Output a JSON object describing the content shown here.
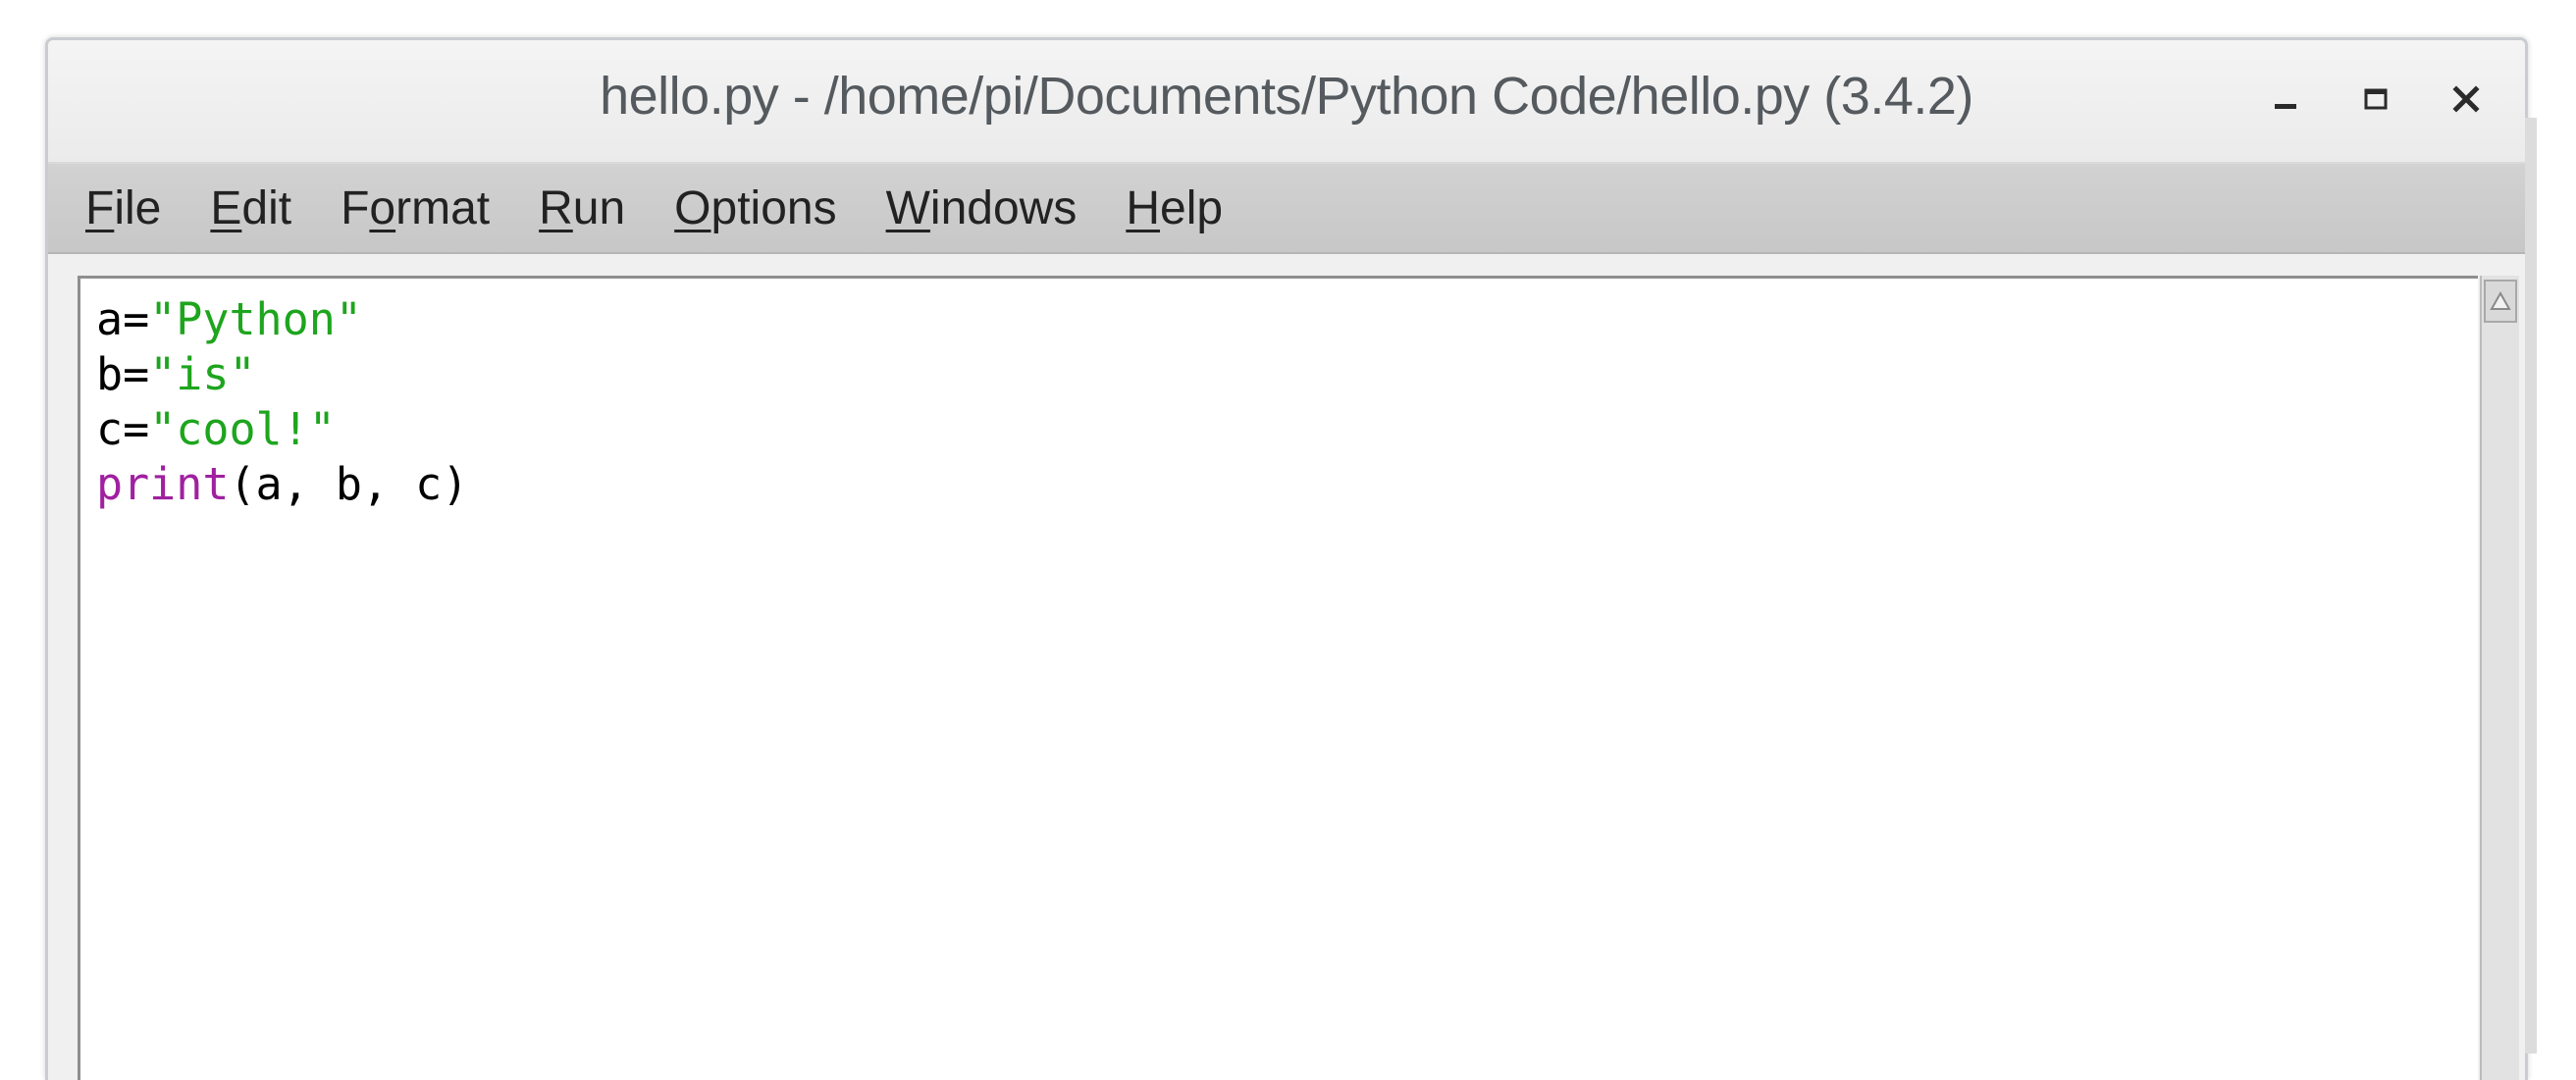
{
  "window": {
    "title": "hello.py - /home/pi/Documents/Python Code/hello.py (3.4.2)",
    "controls": {
      "minimize_icon": "minimize-icon",
      "maximize_icon": "maximize-icon",
      "close_icon": "close-icon"
    }
  },
  "menubar": {
    "items": [
      {
        "first": "F",
        "rest": "ile",
        "label": "File"
      },
      {
        "first": "E",
        "rest": "dit",
        "label": "Edit"
      },
      {
        "pre": "F",
        "first": "o",
        "rest": "rmat",
        "label": "Format"
      },
      {
        "first": "R",
        "rest": "un",
        "label": "Run"
      },
      {
        "first": "O",
        "rest": "ptions",
        "label": "Options"
      },
      {
        "first": "W",
        "rest": "indows",
        "label": "Windows"
      },
      {
        "first": "H",
        "rest": "elp",
        "label": "Help"
      }
    ]
  },
  "editor": {
    "lines": [
      {
        "var": "a=",
        "str": "\"Python\""
      },
      {
        "var": "b=",
        "str": "\"is\""
      },
      {
        "var": "c=",
        "str": "\"cool!\""
      },
      {
        "kw": "print",
        "rest": "(a, b, c)"
      }
    ]
  },
  "colors": {
    "string": "#1ea51e",
    "keyword": "#a020a0",
    "title_text": "#555a5f"
  }
}
